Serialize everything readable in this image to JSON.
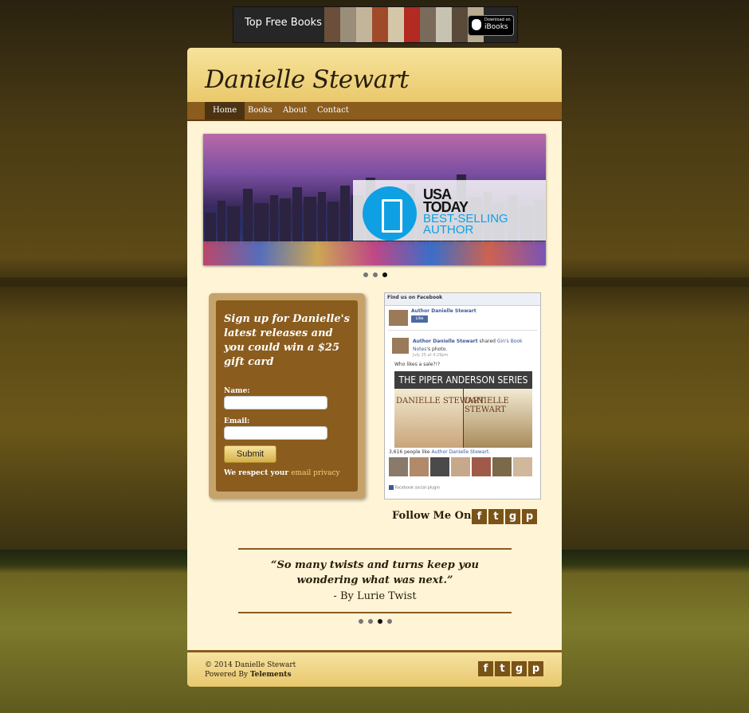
{
  "ad_banner": {
    "text": "Top Free Books",
    "button_small": "Download on",
    "button_big": "iBooks"
  },
  "site": {
    "title": "Danielle Stewart"
  },
  "nav": {
    "items": [
      "Home",
      "Books",
      "About",
      "Contact"
    ],
    "active": "Home"
  },
  "slider": {
    "usa_line1": "USA",
    "usa_line2": "TODAY",
    "badge_line1": "BEST-SELLING",
    "badge_line2": "AUTHOR",
    "slide_count": 3,
    "active_slide": 3
  },
  "signup": {
    "heading": "Sign up for Danielle's latest releases and you could win a $25 gift card",
    "name_label": "Name:",
    "email_label": "Email:",
    "submit_label": "Submit",
    "privacy_text": "We respect your",
    "privacy_link": "email privacy"
  },
  "facebook": {
    "header": "Find us on Facebook",
    "page_name": "Author Danielle Stewart",
    "like_label": "Like",
    "post_author": "Author Danielle Stewart",
    "post_shared": "shared",
    "post_source": "Gin's Book",
    "post_source2": "Notes",
    "post_suffix": "'s photo.",
    "post_date": "July 25 at 4:29pm",
    "post_text": "Who likes a sale?!?",
    "image_title": "THE PIPER ANDERSON SERIES",
    "image_author_left": "DANIELLE STEWART",
    "image_author_right": "DANIELLE STEWART",
    "likes_count": "3,616 people like",
    "likes_page": "Author Danielle Stewart.",
    "plugin_label": "Facebook social plugin"
  },
  "follow": {
    "label": "Follow Me On:",
    "icons": [
      "facebook-icon",
      "twitter-icon",
      "google-plus-icon",
      "pinterest-icon"
    ]
  },
  "testimonial": {
    "quote_line1": "“So many twists and turns keep you",
    "quote_line2": "wondering what was next.”",
    "byline": "- By Lurie Twist",
    "slide_count": 4,
    "active_slide": 3
  },
  "footer": {
    "copyright": "© 2014 Danielle Stewart",
    "powered_text": "Powered By",
    "powered_link": "Telements"
  },
  "colors": {
    "accent": "#8a5c1e",
    "panel": "#fff4d6",
    "header": "#e9c86a",
    "facebook_blue": "#3b5998"
  }
}
